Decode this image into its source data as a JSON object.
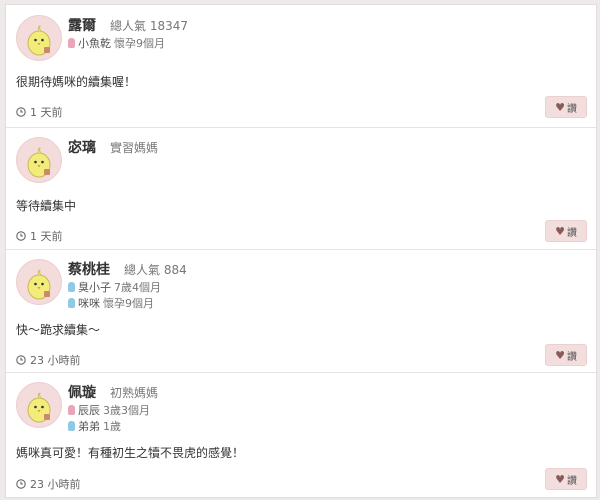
{
  "colors": {
    "pink_kid": "#e8a6b8",
    "blue_kid": "#8fc9e6",
    "button_bg": "#f3dede"
  },
  "icons": {
    "avatar": "chick-avatar-icon",
    "time": "clock-icon",
    "like": "heart-icon"
  },
  "like_label": "讚",
  "comments": [
    {
      "name": "露爾",
      "level": "總人氣 18347",
      "kids": [
        {
          "color": "pink",
          "name": "小魚乾",
          "age": "懷孕9個月"
        }
      ],
      "text": "很期待媽咪的續集喔！",
      "time": "1 天前"
    },
    {
      "name": "宓璃",
      "level": "實習媽媽",
      "kids": [],
      "text": "等待續集中",
      "time": "1 天前"
    },
    {
      "name": "蔡桃桂",
      "level": "總人氣 884",
      "kids": [
        {
          "color": "blue",
          "name": "臭小子",
          "age": "7歲4個月"
        },
        {
          "color": "blue",
          "name": "咪咪",
          "age": "懷孕9個月"
        }
      ],
      "text": "快～跪求續集～",
      "time": "23 小時前"
    },
    {
      "name": "佩璇",
      "level": "初熟媽媽",
      "kids": [
        {
          "color": "pink",
          "name": "辰辰",
          "age": "3歲3個月"
        },
        {
          "color": "blue",
          "name": "弟弟",
          "age": "1歲"
        }
      ],
      "text": "媽咪真可愛！有種初生之犢不畏虎的感覺！",
      "time": "23 小時前"
    }
  ]
}
